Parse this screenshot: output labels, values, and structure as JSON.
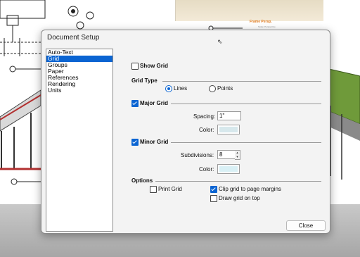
{
  "background": {
    "photo_label": "Frame Persp.",
    "photo_sub": "Scale: Perspective"
  },
  "dialog": {
    "title": "Document Setup",
    "categories": [
      "Auto-Text",
      "Grid",
      "Groups",
      "Paper",
      "References",
      "Rendering",
      "Units"
    ],
    "selected_category": "Grid",
    "show_grid": {
      "label": "Show Grid",
      "checked": false
    },
    "grid_type": {
      "header": "Grid Type",
      "lines_label": "Lines",
      "points_label": "Points",
      "selected": "Lines"
    },
    "major_grid": {
      "label": "Major Grid",
      "checked": true,
      "spacing_label": "Spacing:",
      "spacing_value": "1\"",
      "color_label": "Color:",
      "color": "#d7e8ec"
    },
    "minor_grid": {
      "label": "Minor Grid",
      "checked": true,
      "subdivisions_label": "Subdivisions:",
      "subdivisions_value": "8",
      "color_label": "Color:",
      "color": "#d9f0f5"
    },
    "options": {
      "header": "Options",
      "print_grid": {
        "label": "Print Grid",
        "checked": false
      },
      "clip_grid": {
        "label": "Clip grid to page margins",
        "checked": true
      },
      "draw_on_top": {
        "label": "Draw grid on top",
        "checked": false
      }
    },
    "close_label": "Close"
  },
  "colors": {
    "accent": "#0a64d2",
    "roof_green": "#6f9a3a",
    "beam_red": "#b23030"
  }
}
